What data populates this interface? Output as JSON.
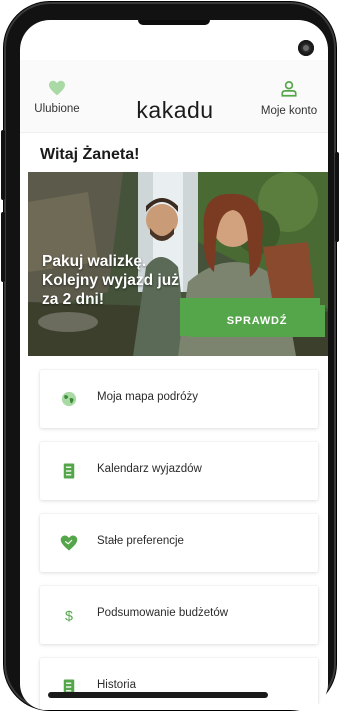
{
  "header": {
    "favorites_label": "Ulubione",
    "logo_text": "kakadu",
    "account_label": "Moje konto"
  },
  "greeting": "Witaj Żaneta!",
  "banner": {
    "line1": "Pakuj walizkę.",
    "line2": "Kolejny wyjazd już",
    "line3": "za 2 dni!",
    "cta_label": "SPRAWDŹ"
  },
  "menu": [
    {
      "label": "Moja mapa podróży",
      "icon": "globe-icon"
    },
    {
      "label": "Kalendarz wyjazdów",
      "icon": "book-icon"
    },
    {
      "label": "Stałe preferencje",
      "icon": "heart-icon"
    },
    {
      "label": "Podsumowanie budżetów",
      "icon": "dollar-icon"
    },
    {
      "label": "Historia",
      "icon": "book-icon"
    }
  ],
  "colors": {
    "accent": "#55a64a",
    "icon_light": "#a9d9a4",
    "frame": "#121212"
  }
}
